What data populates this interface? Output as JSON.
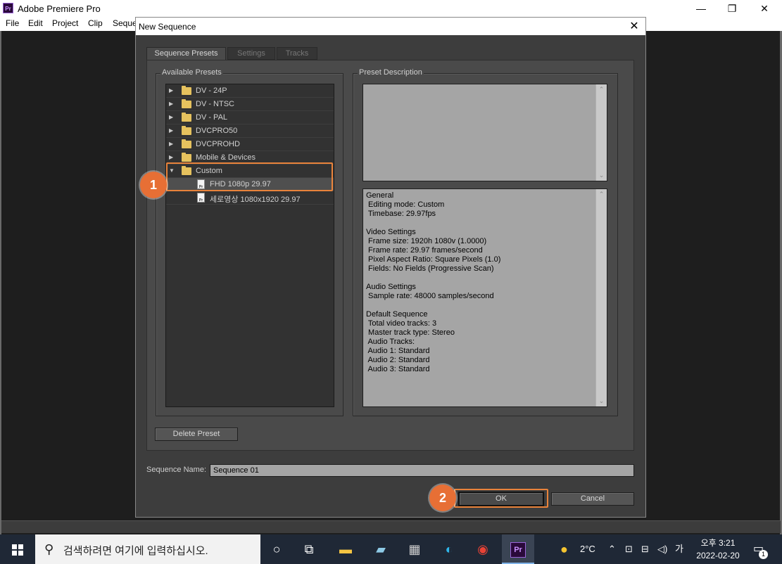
{
  "app": {
    "icon": "Pr",
    "title": "Adobe Premiere Pro",
    "menu": [
      "File",
      "Edit",
      "Project",
      "Clip",
      "Seque"
    ],
    "controls": {
      "minimize": "—",
      "maximize": "❐",
      "close": "✕"
    }
  },
  "dialog": {
    "title": "New Sequence",
    "close": "✕",
    "tabs": [
      "Sequence Presets",
      "Settings",
      "Tracks"
    ],
    "presets_label": "Available Presets",
    "presets": [
      {
        "label": "DV - 24P",
        "type": "folder",
        "expanded": false
      },
      {
        "label": "DV - NTSC",
        "type": "folder",
        "expanded": false
      },
      {
        "label": "DV - PAL",
        "type": "folder",
        "expanded": false
      },
      {
        "label": "DVCPRO50",
        "type": "folder",
        "expanded": false
      },
      {
        "label": "DVCPROHD",
        "type": "folder",
        "expanded": false
      },
      {
        "label": "Mobile & Devices",
        "type": "folder",
        "expanded": false
      },
      {
        "label": "Custom",
        "type": "folder",
        "expanded": true
      },
      {
        "label": "FHD 1080p 29.97",
        "type": "file",
        "selected": true
      },
      {
        "label": "세로영상 1080x1920 29.97",
        "type": "file",
        "selected": false
      }
    ],
    "file_icon_text": "Pr",
    "description_label": "Preset Description",
    "description_text": "General\n Editing mode: Custom\n Timebase: 29.97fps\n\nVideo Settings\n Frame size: 1920h 1080v (1.0000)\n Frame rate: 29.97 frames/second\n Pixel Aspect Ratio: Square Pixels (1.0)\n Fields: No Fields (Progressive Scan)\n\nAudio Settings\n Sample rate: 48000 samples/second\n\nDefault Sequence\n Total video tracks: 3\n Master track type: Stereo\n Audio Tracks:\n Audio 1: Standard\n Audio 2: Standard\n Audio 3: Standard",
    "delete_preset": "Delete Preset",
    "sequence_name_label": "Sequence Name:",
    "sequence_name_value": "Sequence 01",
    "ok": "OK",
    "cancel": "Cancel"
  },
  "annotations": {
    "step1": "1",
    "step2": "2"
  },
  "taskbar": {
    "search_placeholder": "검색하려면 여기에 입력하십시오.",
    "weather": "2°C",
    "ime": "가",
    "time_period": "오후 3:21",
    "date": "2022-02-20",
    "notification_count": "1",
    "active_app": "Pr"
  }
}
